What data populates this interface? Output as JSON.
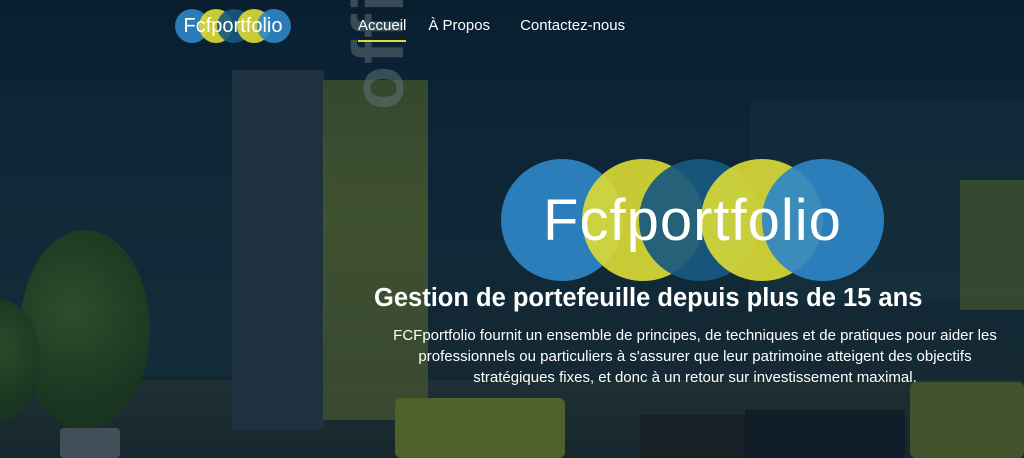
{
  "brand": {
    "name": "Fcfportfolio",
    "colors": {
      "blue": "#2f86c7",
      "yellow": "#dddd35",
      "dark_blue": "#17587f",
      "accent_underline": "#e4d93a"
    }
  },
  "nav": {
    "links": [
      {
        "label": "Accueil",
        "active": true
      },
      {
        "label": "À Propos",
        "active": false
      },
      {
        "label": "Contactez-nous",
        "active": false
      }
    ]
  },
  "hero": {
    "logo_text": "Fcfportfolio",
    "headline": "Gestion de portefeuille depuis plus de 15 ans",
    "description": "FCFportfolio fournit un ensemble de principes, de techniques et de pratiques pour aider les professionnels ou particuliers à s'assurer que leur patrimoine atteigent des objectifs stratégiques fixes, et donc à un retour sur investissement maximal.",
    "background_text": "office"
  }
}
